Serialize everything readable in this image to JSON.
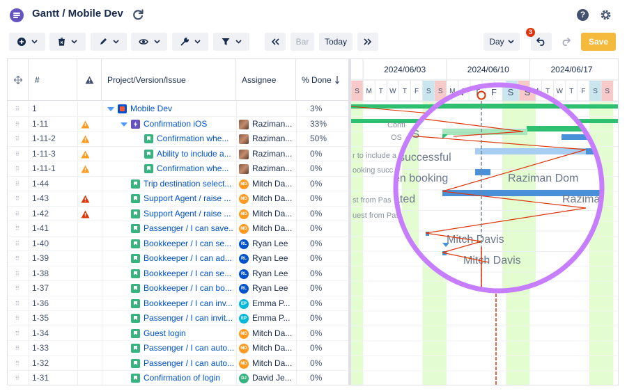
{
  "header": {
    "title": "Gantt / Mobile Dev",
    "help_label": "?"
  },
  "toolbar": {
    "bar_label": "Bar",
    "today_label": "Today",
    "day_label": "Day",
    "save_label": "Save",
    "undo_badge": "3"
  },
  "table": {
    "columns": [
      "#",
      "Project/Version/Issue",
      "Assignee",
      "% Done"
    ],
    "rows": [
      {
        "num": "1",
        "warn": "",
        "indent": 0,
        "type": "project",
        "caret": true,
        "issue": "Mobile Dev",
        "assignee": "",
        "avatar": "",
        "avatar_color": "",
        "pct": "3%"
      },
      {
        "num": "1-11",
        "warn": "orange",
        "indent": 1,
        "type": "epic",
        "caret": true,
        "issue": "Confirmation iOS",
        "assignee": "Raziman...",
        "avatar": "photo",
        "avatar_color": "",
        "pct": "33%"
      },
      {
        "num": "1-11-2",
        "warn": "orange",
        "indent": 2,
        "type": "story",
        "caret": false,
        "issue": "Confirmation whe...",
        "assignee": "Raziman...",
        "avatar": "photo",
        "avatar_color": "",
        "pct": "50%"
      },
      {
        "num": "1-11-3",
        "warn": "orange",
        "indent": 2,
        "type": "story",
        "caret": false,
        "issue": "Ability to include a...",
        "assignee": "Raziman...",
        "avatar": "photo",
        "avatar_color": "",
        "pct": "0%"
      },
      {
        "num": "1-11-1",
        "warn": "orange",
        "indent": 2,
        "type": "story",
        "caret": false,
        "issue": "Confirmation whe...",
        "assignee": "Raziman...",
        "avatar": "photo",
        "avatar_color": "",
        "pct": "0%"
      },
      {
        "num": "1-44",
        "warn": "",
        "indent": 1,
        "type": "story",
        "caret": false,
        "issue": "Trip destination select...",
        "assignee": "Mitch Da...",
        "avatar": "MD",
        "avatar_color": "#ff991f",
        "pct": "0%"
      },
      {
        "num": "1-43",
        "warn": "red",
        "indent": 1,
        "type": "story",
        "caret": false,
        "issue": "Support Agent / raise ...",
        "assignee": "Mitch Da...",
        "avatar": "MD",
        "avatar_color": "#ff991f",
        "pct": "0%"
      },
      {
        "num": "1-42",
        "warn": "red",
        "indent": 1,
        "type": "story",
        "caret": false,
        "issue": "Support Agent / raise ...",
        "assignee": "Mitch Da...",
        "avatar": "MD",
        "avatar_color": "#ff991f",
        "pct": "0%"
      },
      {
        "num": "1-41",
        "warn": "",
        "indent": 1,
        "type": "story",
        "caret": false,
        "issue": "Passenger / I can save...",
        "assignee": "Mitch Da...",
        "avatar": "MD",
        "avatar_color": "#ff991f",
        "pct": "0%"
      },
      {
        "num": "1-40",
        "warn": "",
        "indent": 1,
        "type": "story",
        "caret": false,
        "issue": "Bookkeeper / I can se...",
        "assignee": "Ryan Lee",
        "avatar": "RL",
        "avatar_color": "#0052cc",
        "pct": "0%"
      },
      {
        "num": "1-39",
        "warn": "",
        "indent": 1,
        "type": "story",
        "caret": false,
        "issue": "Bookkeeper / I can ad...",
        "assignee": "Ryan Lee",
        "avatar": "RL",
        "avatar_color": "#0052cc",
        "pct": "0%"
      },
      {
        "num": "1-38",
        "warn": "",
        "indent": 1,
        "type": "story",
        "caret": false,
        "issue": "Bookkeeper / I can se...",
        "assignee": "Ryan Lee",
        "avatar": "RL",
        "avatar_color": "#0052cc",
        "pct": "0%"
      },
      {
        "num": "1-37",
        "warn": "",
        "indent": 1,
        "type": "story",
        "caret": false,
        "issue": "Bookkeeper / I can bo...",
        "assignee": "Ryan Lee",
        "avatar": "RL",
        "avatar_color": "#0052cc",
        "pct": "0%"
      },
      {
        "num": "1-36",
        "warn": "",
        "indent": 1,
        "type": "story",
        "caret": false,
        "issue": "Bookkeeper / I can inv...",
        "assignee": "Emma P...",
        "avatar": "EP",
        "avatar_color": "#00b8d9",
        "pct": "0%"
      },
      {
        "num": "1-35",
        "warn": "",
        "indent": 1,
        "type": "story",
        "caret": false,
        "issue": "Passenger / I can invit...",
        "assignee": "Emma P...",
        "avatar": "EP",
        "avatar_color": "#00b8d9",
        "pct": "0%"
      },
      {
        "num": "1-34",
        "warn": "",
        "indent": 1,
        "type": "story",
        "caret": false,
        "issue": "Guest login",
        "assignee": "Mitch Da...",
        "avatar": "MD",
        "avatar_color": "#ff991f",
        "pct": "0%"
      },
      {
        "num": "1-33",
        "warn": "",
        "indent": 1,
        "type": "story",
        "caret": false,
        "issue": "Passenger / I can auto...",
        "assignee": "Mitch Da...",
        "avatar": "MD",
        "avatar_color": "#ff991f",
        "pct": "0%"
      },
      {
        "num": "1-32",
        "warn": "",
        "indent": 1,
        "type": "story",
        "caret": false,
        "issue": "Passenger / I can auto...",
        "assignee": "Mitch Da...",
        "avatar": "MD",
        "avatar_color": "#ff991f",
        "pct": "0%"
      },
      {
        "num": "1-31",
        "warn": "",
        "indent": 1,
        "type": "story",
        "caret": false,
        "issue": "Confirmation of login",
        "assignee": "David Je...",
        "avatar": "DJ",
        "avatar_color": "#36b37e",
        "pct": "0%"
      }
    ]
  },
  "gantt": {
    "week_labels": [
      "2024/06/03",
      "2024/06/10",
      "2024/06/17"
    ],
    "day_letters": [
      "S",
      "M",
      "T",
      "W",
      "T",
      "F",
      "S",
      "S",
      "M",
      "T",
      "W",
      "T",
      "F",
      "S",
      "S",
      "M",
      "T",
      "W",
      "T",
      "F",
      "S",
      "S"
    ],
    "weekend_days": [
      0,
      6,
      7,
      13,
      14,
      20,
      21
    ],
    "bar_labels": [
      "Confi",
      "OS",
      "r to include a",
      "ooking succ",
      "st from Pas",
      "uest from Pas"
    ],
    "magnifier": {
      "day_letters": [
        "W",
        "T",
        "F",
        "S",
        "S"
      ],
      "labels": [
        "OS",
        "successful",
        "en booking",
        "Raziman Dom",
        "ated",
        "Razima",
        "Mitch Davis",
        "Mitch Davis"
      ]
    }
  },
  "colors": {
    "accent": "#0052cc",
    "brand": "#6554c0",
    "save": "#f5b93b",
    "weekend_green": "#e3fcd0",
    "bar_green": "#2fbf71",
    "bar_blue": "#4a90d9",
    "today_line": "#de350b",
    "magnifier_ring": "#c77dff"
  }
}
